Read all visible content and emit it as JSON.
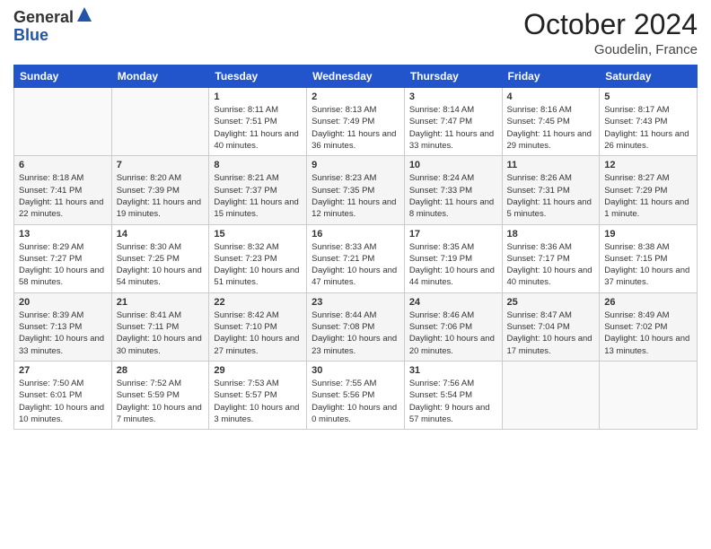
{
  "logo": {
    "general": "General",
    "blue": "Blue"
  },
  "header": {
    "month": "October 2024",
    "location": "Goudelin, France"
  },
  "weekdays": [
    "Sunday",
    "Monday",
    "Tuesday",
    "Wednesday",
    "Thursday",
    "Friday",
    "Saturday"
  ],
  "weeks": [
    [
      {
        "date": "",
        "sunrise": "",
        "sunset": "",
        "daylight": ""
      },
      {
        "date": "",
        "sunrise": "",
        "sunset": "",
        "daylight": ""
      },
      {
        "date": "1",
        "sunrise": "Sunrise: 8:11 AM",
        "sunset": "Sunset: 7:51 PM",
        "daylight": "Daylight: 11 hours and 40 minutes."
      },
      {
        "date": "2",
        "sunrise": "Sunrise: 8:13 AM",
        "sunset": "Sunset: 7:49 PM",
        "daylight": "Daylight: 11 hours and 36 minutes."
      },
      {
        "date": "3",
        "sunrise": "Sunrise: 8:14 AM",
        "sunset": "Sunset: 7:47 PM",
        "daylight": "Daylight: 11 hours and 33 minutes."
      },
      {
        "date": "4",
        "sunrise": "Sunrise: 8:16 AM",
        "sunset": "Sunset: 7:45 PM",
        "daylight": "Daylight: 11 hours and 29 minutes."
      },
      {
        "date": "5",
        "sunrise": "Sunrise: 8:17 AM",
        "sunset": "Sunset: 7:43 PM",
        "daylight": "Daylight: 11 hours and 26 minutes."
      }
    ],
    [
      {
        "date": "6",
        "sunrise": "Sunrise: 8:18 AM",
        "sunset": "Sunset: 7:41 PM",
        "daylight": "Daylight: 11 hours and 22 minutes."
      },
      {
        "date": "7",
        "sunrise": "Sunrise: 8:20 AM",
        "sunset": "Sunset: 7:39 PM",
        "daylight": "Daylight: 11 hours and 19 minutes."
      },
      {
        "date": "8",
        "sunrise": "Sunrise: 8:21 AM",
        "sunset": "Sunset: 7:37 PM",
        "daylight": "Daylight: 11 hours and 15 minutes."
      },
      {
        "date": "9",
        "sunrise": "Sunrise: 8:23 AM",
        "sunset": "Sunset: 7:35 PM",
        "daylight": "Daylight: 11 hours and 12 minutes."
      },
      {
        "date": "10",
        "sunrise": "Sunrise: 8:24 AM",
        "sunset": "Sunset: 7:33 PM",
        "daylight": "Daylight: 11 hours and 8 minutes."
      },
      {
        "date": "11",
        "sunrise": "Sunrise: 8:26 AM",
        "sunset": "Sunset: 7:31 PM",
        "daylight": "Daylight: 11 hours and 5 minutes."
      },
      {
        "date": "12",
        "sunrise": "Sunrise: 8:27 AM",
        "sunset": "Sunset: 7:29 PM",
        "daylight": "Daylight: 11 hours and 1 minute."
      }
    ],
    [
      {
        "date": "13",
        "sunrise": "Sunrise: 8:29 AM",
        "sunset": "Sunset: 7:27 PM",
        "daylight": "Daylight: 10 hours and 58 minutes."
      },
      {
        "date": "14",
        "sunrise": "Sunrise: 8:30 AM",
        "sunset": "Sunset: 7:25 PM",
        "daylight": "Daylight: 10 hours and 54 minutes."
      },
      {
        "date": "15",
        "sunrise": "Sunrise: 8:32 AM",
        "sunset": "Sunset: 7:23 PM",
        "daylight": "Daylight: 10 hours and 51 minutes."
      },
      {
        "date": "16",
        "sunrise": "Sunrise: 8:33 AM",
        "sunset": "Sunset: 7:21 PM",
        "daylight": "Daylight: 10 hours and 47 minutes."
      },
      {
        "date": "17",
        "sunrise": "Sunrise: 8:35 AM",
        "sunset": "Sunset: 7:19 PM",
        "daylight": "Daylight: 10 hours and 44 minutes."
      },
      {
        "date": "18",
        "sunrise": "Sunrise: 8:36 AM",
        "sunset": "Sunset: 7:17 PM",
        "daylight": "Daylight: 10 hours and 40 minutes."
      },
      {
        "date": "19",
        "sunrise": "Sunrise: 8:38 AM",
        "sunset": "Sunset: 7:15 PM",
        "daylight": "Daylight: 10 hours and 37 minutes."
      }
    ],
    [
      {
        "date": "20",
        "sunrise": "Sunrise: 8:39 AM",
        "sunset": "Sunset: 7:13 PM",
        "daylight": "Daylight: 10 hours and 33 minutes."
      },
      {
        "date": "21",
        "sunrise": "Sunrise: 8:41 AM",
        "sunset": "Sunset: 7:11 PM",
        "daylight": "Daylight: 10 hours and 30 minutes."
      },
      {
        "date": "22",
        "sunrise": "Sunrise: 8:42 AM",
        "sunset": "Sunset: 7:10 PM",
        "daylight": "Daylight: 10 hours and 27 minutes."
      },
      {
        "date": "23",
        "sunrise": "Sunrise: 8:44 AM",
        "sunset": "Sunset: 7:08 PM",
        "daylight": "Daylight: 10 hours and 23 minutes."
      },
      {
        "date": "24",
        "sunrise": "Sunrise: 8:46 AM",
        "sunset": "Sunset: 7:06 PM",
        "daylight": "Daylight: 10 hours and 20 minutes."
      },
      {
        "date": "25",
        "sunrise": "Sunrise: 8:47 AM",
        "sunset": "Sunset: 7:04 PM",
        "daylight": "Daylight: 10 hours and 17 minutes."
      },
      {
        "date": "26",
        "sunrise": "Sunrise: 8:49 AM",
        "sunset": "Sunset: 7:02 PM",
        "daylight": "Daylight: 10 hours and 13 minutes."
      }
    ],
    [
      {
        "date": "27",
        "sunrise": "Sunrise: 7:50 AM",
        "sunset": "Sunset: 6:01 PM",
        "daylight": "Daylight: 10 hours and 10 minutes."
      },
      {
        "date": "28",
        "sunrise": "Sunrise: 7:52 AM",
        "sunset": "Sunset: 5:59 PM",
        "daylight": "Daylight: 10 hours and 7 minutes."
      },
      {
        "date": "29",
        "sunrise": "Sunrise: 7:53 AM",
        "sunset": "Sunset: 5:57 PM",
        "daylight": "Daylight: 10 hours and 3 minutes."
      },
      {
        "date": "30",
        "sunrise": "Sunrise: 7:55 AM",
        "sunset": "Sunset: 5:56 PM",
        "daylight": "Daylight: 10 hours and 0 minutes."
      },
      {
        "date": "31",
        "sunrise": "Sunrise: 7:56 AM",
        "sunset": "Sunset: 5:54 PM",
        "daylight": "Daylight: 9 hours and 57 minutes."
      },
      {
        "date": "",
        "sunrise": "",
        "sunset": "",
        "daylight": ""
      },
      {
        "date": "",
        "sunrise": "",
        "sunset": "",
        "daylight": ""
      }
    ]
  ]
}
